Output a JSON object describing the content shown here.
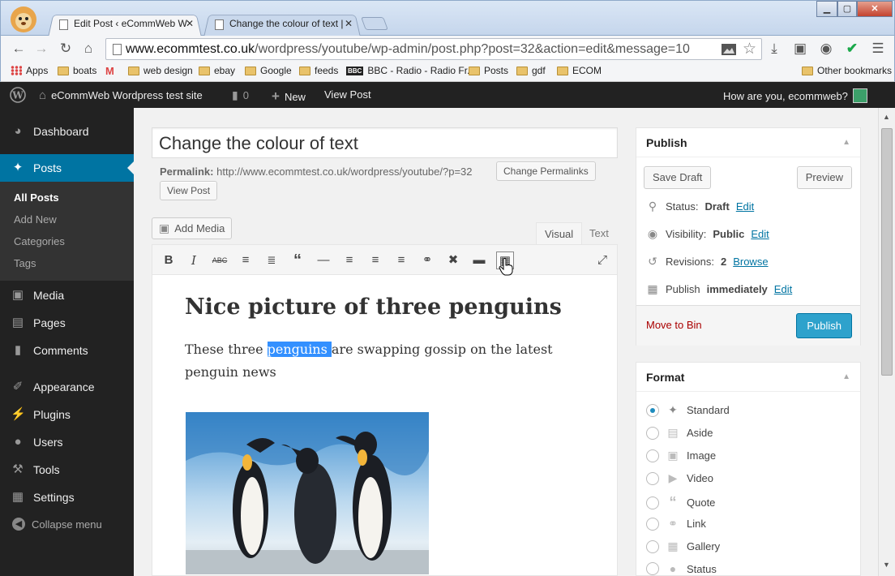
{
  "browser": {
    "tabs": [
      {
        "title": "Edit Post ‹ eCommWeb Word",
        "close": "✕"
      },
      {
        "title": "Change the colour of text | e",
        "close": "✕"
      }
    ],
    "window_buttons": {
      "minimize": "▁",
      "maximize": "▢",
      "close": "✕"
    },
    "url_host": "www.ecommtest.co.uk",
    "url_path": "/wordpress/youtube/wp-admin/post.php?post=32&action=edit&message=10",
    "bookmarks": [
      "Apps",
      "boats",
      "web design",
      "ebay",
      "Google",
      "feeds",
      "BBC - Radio - Radio Fr...",
      "Posts",
      "gdf",
      "ECOM"
    ],
    "other_bookmarks": "Other bookmarks"
  },
  "adminbar": {
    "site_name": "eCommWeb Wordpress test site",
    "comments_count": "0",
    "new_label": "New",
    "view_post": "View Post",
    "greeting": "How are you, ecommweb?"
  },
  "sidebar": {
    "items": [
      {
        "label": "Dashboard",
        "icon": "dashboard-icon"
      },
      {
        "label": "Posts",
        "icon": "pin-icon"
      },
      {
        "label": "Media",
        "icon": "media-icon"
      },
      {
        "label": "Pages",
        "icon": "pages-icon"
      },
      {
        "label": "Comments",
        "icon": "comment-icon"
      },
      {
        "label": "Appearance",
        "icon": "brush-icon"
      },
      {
        "label": "Plugins",
        "icon": "plug-icon"
      },
      {
        "label": "Users",
        "icon": "user-icon"
      },
      {
        "label": "Tools",
        "icon": "wrench-icon"
      },
      {
        "label": "Settings",
        "icon": "settings-icon"
      }
    ],
    "submenu": [
      "All Posts",
      "Add New",
      "Categories",
      "Tags"
    ],
    "collapse": "Collapse menu"
  },
  "post": {
    "title": "Change the colour of text",
    "permalink_label": "Permalink:",
    "permalink_url": "http://www.ecommtest.co.uk/wordpress/youtube/?p=32",
    "change_permalinks": "Change Permalinks",
    "view_post": "View Post",
    "add_media": "Add Media",
    "tab_visual": "Visual",
    "tab_text": "Text",
    "heading": "Nice picture of three penguins",
    "para_before": "These three ",
    "para_selected": "penguins ",
    "para_after": "are swapping gossip on the latest penguin news"
  },
  "publish": {
    "title": "Publish",
    "save_draft": "Save Draft",
    "preview": "Preview",
    "status_label": "Status:",
    "status_value": "Draft",
    "visibility_label": "Visibility:",
    "visibility_value": "Public",
    "revisions_label": "Revisions:",
    "revisions_value": "2",
    "browse": "Browse",
    "publish_label": "Publish",
    "publish_value": "immediately",
    "edit": "Edit",
    "move_to_bin": "Move to Bin",
    "publish_button": "Publish"
  },
  "format": {
    "title": "Format",
    "options": [
      "Standard",
      "Aside",
      "Image",
      "Video",
      "Quote",
      "Link",
      "Gallery",
      "Status"
    ],
    "selected": "Standard"
  },
  "colors": {
    "accent": "#0074a2",
    "publish_button": "#2ea2cc",
    "selection": "#3390ff"
  }
}
